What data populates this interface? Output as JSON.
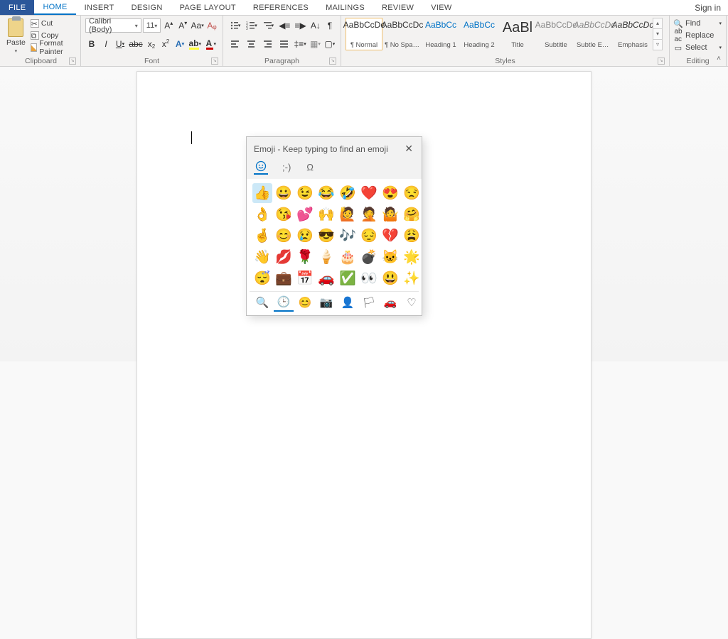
{
  "tabs": {
    "file": "FILE",
    "home": "HOME",
    "insert": "INSERT",
    "design": "DESIGN",
    "page_layout": "PAGE LAYOUT",
    "references": "REFERENCES",
    "mailings": "MAILINGS",
    "review": "REVIEW",
    "view": "VIEW"
  },
  "signin": "Sign in",
  "clipboard": {
    "paste": "Paste",
    "cut": "Cut",
    "copy": "Copy",
    "format_painter": "Format Painter",
    "label": "Clipboard"
  },
  "font": {
    "name": "Calibri (Body)",
    "size": "11",
    "label": "Font"
  },
  "paragraph": {
    "label": "Paragraph"
  },
  "styles": {
    "label": "Styles",
    "items": [
      {
        "name": "¶ Normal",
        "preview": "AaBbCcDc",
        "cls": ""
      },
      {
        "name": "¶ No Spac…",
        "preview": "AaBbCcDc",
        "cls": ""
      },
      {
        "name": "Heading 1",
        "preview": "AaBbCc",
        "cls": "blue"
      },
      {
        "name": "Heading 2",
        "preview": "AaBbCc",
        "cls": "blue"
      },
      {
        "name": "Title",
        "preview": "AaBl",
        "cls": "big"
      },
      {
        "name": "Subtitle",
        "preview": "AaBbCcDc",
        "cls": "grey"
      },
      {
        "name": "Subtle Em…",
        "preview": "AaBbCcDc",
        "cls": "grey italic"
      },
      {
        "name": "Emphasis",
        "preview": "AaBbCcDc",
        "cls": "italic"
      }
    ]
  },
  "editing": {
    "find": "Find",
    "replace": "Replace",
    "select": "Select",
    "label": "Editing"
  },
  "emoji": {
    "title": "Emoji - Keep typing to find an emoji",
    "tabs": {
      "emoji": "☺",
      "kaomoji": ";-)",
      "symbols": "Ω"
    },
    "grid": [
      "👍",
      "😀",
      "😉",
      "😂",
      "🤣",
      "❤️",
      "😍",
      "😒",
      "👌",
      "😘",
      "💕",
      "🙌",
      "🙋",
      "🤦",
      "🤷",
      "🤗",
      "🤞",
      "😊",
      "😢",
      "😎",
      "🎶",
      "😔",
      "💔",
      "😩",
      "👋",
      "💋",
      "🌹",
      "🍦",
      "🎂",
      "💣",
      "🐱",
      "🌟",
      "😴",
      "💼",
      "📅",
      "🚗",
      "✅",
      "👀",
      "😃",
      "✨"
    ],
    "categories": [
      "🔍",
      "🕒",
      "😊",
      "📷",
      "👤",
      "🏳",
      "🚗",
      "♡"
    ]
  }
}
